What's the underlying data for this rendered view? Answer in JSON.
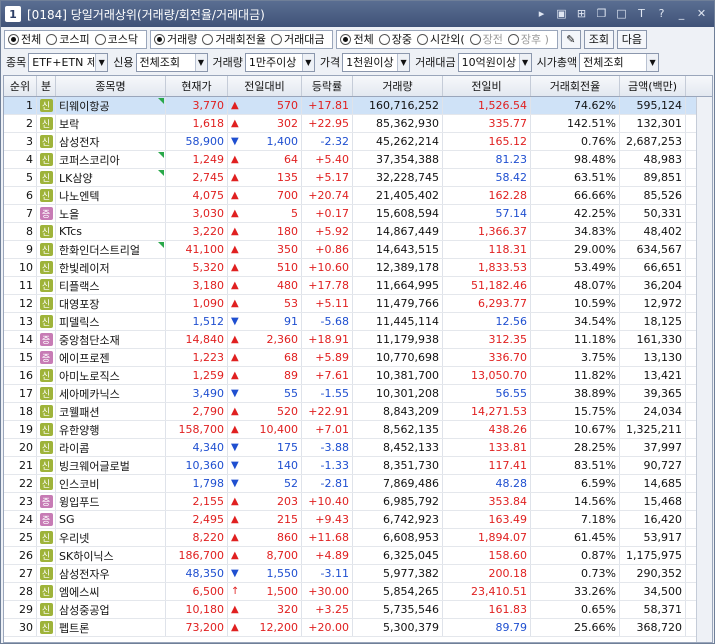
{
  "window": {
    "number": "1",
    "title": "[0184] 당일거래상위(거래량/회전율/거래대금)"
  },
  "title_icons": [
    "dropdown-icon",
    "m-icon",
    "layout-icon",
    "copy-icon",
    "window-icon",
    "text-icon",
    "help-icon",
    "minimize-icon",
    "close-icon"
  ],
  "filters": {
    "market": {
      "options": [
        "전체",
        "코스피",
        "코스닥"
      ],
      "selected": 0
    },
    "sort": {
      "options": [
        "거래량",
        "거래회전율",
        "거래대금"
      ],
      "selected": 0
    },
    "session": {
      "options": [
        "전체",
        "장중",
        "시간외(",
        "장전",
        "장후 )"
      ],
      "selected": 0
    },
    "query_button": "조회",
    "next_button": "다음",
    "row2": {
      "item_label": "종목",
      "item_value": "ETF+ETN 제",
      "credit_label": "신용",
      "credit_value": "전체조회",
      "volume_label": "거래량",
      "volume_value": "1만주이상",
      "price_label": "가격",
      "price_value": "1천원이상",
      "amount_label": "거래대금",
      "amount_value": "10억원이상",
      "cap_label": "시가총액",
      "cap_value": "전체조회"
    }
  },
  "table": {
    "headers": [
      "순위",
      "분",
      "종목명",
      "현재가",
      "전일대비",
      "등락률",
      "거래량",
      "전일비",
      "거래회전율",
      "금액(백만)"
    ],
    "rows": [
      {
        "rank": "1",
        "tag": "신",
        "name": "티웨이항공",
        "price": "3,770",
        "dir": "up",
        "chg": "570",
        "rate": "+17.81",
        "vol": "160,716,252",
        "prev": "1,526.54",
        "turn": "74.62%",
        "amt": "595,124",
        "mark": true
      },
      {
        "rank": "2",
        "tag": "신",
        "name": "보락",
        "price": "1,618",
        "dir": "up",
        "chg": "302",
        "rate": "+22.95",
        "vol": "85,362,930",
        "prev": "335.77",
        "turn": "142.51%",
        "amt": "132,301",
        "mark": false
      },
      {
        "rank": "3",
        "tag": "신",
        "name": "삼성전자",
        "price": "58,900",
        "dir": "down",
        "chg": "1,400",
        "rate": "-2.32",
        "vol": "45,262,214",
        "prev": "165.12",
        "turn": "0.76%",
        "amt": "2,687,253",
        "mark": false
      },
      {
        "rank": "4",
        "tag": "신",
        "name": "코퍼스코리아",
        "price": "1,249",
        "dir": "up",
        "chg": "64",
        "rate": "+5.40",
        "vol": "37,354,388",
        "prev": "81.23",
        "turn": "98.48%",
        "amt": "48,983",
        "mark": true
      },
      {
        "rank": "5",
        "tag": "신",
        "name": "LK삼양",
        "price": "2,745",
        "dir": "up",
        "chg": "135",
        "rate": "+5.17",
        "vol": "32,228,745",
        "prev": "58.42",
        "turn": "63.51%",
        "amt": "89,851",
        "mark": true
      },
      {
        "rank": "6",
        "tag": "신",
        "name": "나노엔텍",
        "price": "4,075",
        "dir": "up",
        "chg": "700",
        "rate": "+20.74",
        "vol": "21,405,402",
        "prev": "162.28",
        "turn": "66.66%",
        "amt": "85,526",
        "mark": false
      },
      {
        "rank": "7",
        "tag": "증",
        "name": "노을",
        "price": "3,030",
        "dir": "up",
        "chg": "5",
        "rate": "+0.17",
        "vol": "15,608,594",
        "prev": "57.14",
        "turn": "42.25%",
        "amt": "50,331",
        "mark": false
      },
      {
        "rank": "8",
        "tag": "신",
        "name": "KTcs",
        "price": "3,220",
        "dir": "up",
        "chg": "180",
        "rate": "+5.92",
        "vol": "14,867,449",
        "prev": "1,366.37",
        "turn": "34.83%",
        "amt": "48,402",
        "mark": false
      },
      {
        "rank": "9",
        "tag": "신",
        "name": "한화인더스트리얼",
        "price": "41,100",
        "dir": "up",
        "chg": "350",
        "rate": "+0.86",
        "vol": "14,643,515",
        "prev": "118.31",
        "turn": "29.00%",
        "amt": "634,567",
        "mark": true
      },
      {
        "rank": "10",
        "tag": "신",
        "name": "한빛레이저",
        "price": "5,320",
        "dir": "up",
        "chg": "510",
        "rate": "+10.60",
        "vol": "12,389,178",
        "prev": "1,833.53",
        "turn": "53.49%",
        "amt": "66,651",
        "mark": false
      },
      {
        "rank": "11",
        "tag": "신",
        "name": "티플랙스",
        "price": "3,180",
        "dir": "up",
        "chg": "480",
        "rate": "+17.78",
        "vol": "11,664,995",
        "prev": "51,182.46",
        "turn": "48.07%",
        "amt": "36,204",
        "mark": false
      },
      {
        "rank": "12",
        "tag": "신",
        "name": "대영포장",
        "price": "1,090",
        "dir": "up",
        "chg": "53",
        "rate": "+5.11",
        "vol": "11,479,766",
        "prev": "6,293.77",
        "turn": "10.59%",
        "amt": "12,972",
        "mark": false
      },
      {
        "rank": "13",
        "tag": "신",
        "name": "피델릭스",
        "price": "1,512",
        "dir": "down",
        "chg": "91",
        "rate": "-5.68",
        "vol": "11,445,114",
        "prev": "12.56",
        "turn": "34.54%",
        "amt": "18,125",
        "mark": false
      },
      {
        "rank": "14",
        "tag": "증",
        "name": "중앙첨단소재",
        "price": "14,840",
        "dir": "up",
        "chg": "2,360",
        "rate": "+18.91",
        "vol": "11,179,938",
        "prev": "312.35",
        "turn": "11.18%",
        "amt": "161,330",
        "mark": false
      },
      {
        "rank": "15",
        "tag": "증",
        "name": "에이프로젠",
        "price": "1,223",
        "dir": "up",
        "chg": "68",
        "rate": "+5.89",
        "vol": "10,770,698",
        "prev": "336.70",
        "turn": "3.75%",
        "amt": "13,130",
        "mark": false
      },
      {
        "rank": "16",
        "tag": "신",
        "name": "아미노로직스",
        "price": "1,259",
        "dir": "up",
        "chg": "89",
        "rate": "+7.61",
        "vol": "10,381,700",
        "prev": "13,050.70",
        "turn": "11.82%",
        "amt": "13,421",
        "mark": false
      },
      {
        "rank": "17",
        "tag": "신",
        "name": "세아메카닉스",
        "price": "3,490",
        "dir": "down",
        "chg": "55",
        "rate": "-1.55",
        "vol": "10,301,208",
        "prev": "56.55",
        "turn": "38.89%",
        "amt": "39,365",
        "mark": false
      },
      {
        "rank": "18",
        "tag": "신",
        "name": "코웰패션",
        "price": "2,790",
        "dir": "up",
        "chg": "520",
        "rate": "+22.91",
        "vol": "8,843,209",
        "prev": "14,271.53",
        "turn": "15.75%",
        "amt": "24,034",
        "mark": false
      },
      {
        "rank": "19",
        "tag": "신",
        "name": "유한양행",
        "price": "158,700",
        "dir": "up",
        "chg": "10,400",
        "rate": "+7.01",
        "vol": "8,562,135",
        "prev": "438.26",
        "turn": "10.67%",
        "amt": "1,325,211",
        "mark": false
      },
      {
        "rank": "20",
        "tag": "신",
        "name": "라이콤",
        "price": "4,340",
        "dir": "down",
        "chg": "175",
        "rate": "-3.88",
        "vol": "8,452,133",
        "prev": "133.81",
        "turn": "28.25%",
        "amt": "37,997",
        "mark": false
      },
      {
        "rank": "21",
        "tag": "신",
        "name": "빙크웨어글로벌",
        "price": "10,360",
        "dir": "down",
        "chg": "140",
        "rate": "-1.33",
        "vol": "8,351,730",
        "prev": "117.41",
        "turn": "83.51%",
        "amt": "90,727",
        "mark": false
      },
      {
        "rank": "22",
        "tag": "신",
        "name": "인스코비",
        "price": "1,798",
        "dir": "down",
        "chg": "52",
        "rate": "-2.81",
        "vol": "7,869,486",
        "prev": "48.28",
        "turn": "6.59%",
        "amt": "14,685",
        "mark": false
      },
      {
        "rank": "23",
        "tag": "증",
        "name": "윙입푸드",
        "price": "2,155",
        "dir": "up",
        "chg": "203",
        "rate": "+10.40",
        "vol": "6,985,792",
        "prev": "353.84",
        "turn": "14.56%",
        "amt": "15,468",
        "mark": false
      },
      {
        "rank": "24",
        "tag": "증",
        "name": "SG",
        "price": "2,495",
        "dir": "up",
        "chg": "215",
        "rate": "+9.43",
        "vol": "6,742,923",
        "prev": "163.49",
        "turn": "7.18%",
        "amt": "16,420",
        "mark": false
      },
      {
        "rank": "25",
        "tag": "신",
        "name": "우리넷",
        "price": "8,220",
        "dir": "up",
        "chg": "860",
        "rate": "+11.68",
        "vol": "6,608,953",
        "prev": "1,894.07",
        "turn": "61.45%",
        "amt": "53,917",
        "mark": false
      },
      {
        "rank": "26",
        "tag": "신",
        "name": "SK하이닉스",
        "price": "186,700",
        "dir": "up",
        "chg": "8,700",
        "rate": "+4.89",
        "vol": "6,325,045",
        "prev": "158.60",
        "turn": "0.87%",
        "amt": "1,175,975",
        "mark": false
      },
      {
        "rank": "27",
        "tag": "신",
        "name": "삼성전자우",
        "price": "48,350",
        "dir": "down",
        "chg": "1,550",
        "rate": "-3.11",
        "vol": "5,977,382",
        "prev": "200.18",
        "turn": "0.73%",
        "amt": "290,352",
        "mark": false
      },
      {
        "rank": "28",
        "tag": "신",
        "name": "엠에스씨",
        "price": "6,500",
        "dir": "limit",
        "chg": "1,500",
        "rate": "+30.00",
        "vol": "5,854,265",
        "prev": "23,410.51",
        "turn": "33.26%",
        "amt": "34,500",
        "mark": false
      },
      {
        "rank": "29",
        "tag": "신",
        "name": "삼성중공업",
        "price": "10,180",
        "dir": "up",
        "chg": "320",
        "rate": "+3.25",
        "vol": "5,735,546",
        "prev": "161.83",
        "turn": "0.65%",
        "amt": "58,371",
        "mark": false
      },
      {
        "rank": "30",
        "tag": "신",
        "name": "펩트론",
        "price": "73,200",
        "dir": "up",
        "chg": "12,200",
        "rate": "+20.00",
        "vol": "5,300,379",
        "prev": "89.79",
        "turn": "25.66%",
        "amt": "368,720",
        "mark": false
      }
    ]
  },
  "colors": {
    "up": "#e02020",
    "down": "#1f4fd0",
    "selected": "#cfe2f7"
  }
}
